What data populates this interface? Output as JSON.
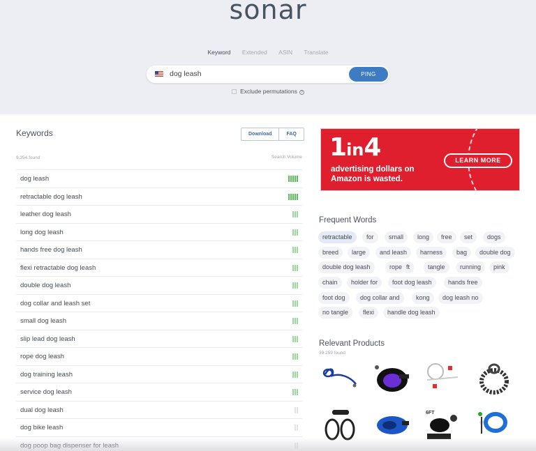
{
  "app": {
    "logo": "sonar"
  },
  "tabs": [
    "Keyword",
    "Extended",
    "ASIN",
    "Translate"
  ],
  "search": {
    "value": "dog leash",
    "button": "PING",
    "flag_icon": "us-flag-icon"
  },
  "exclude_label": "Exclude permutations",
  "keywords": {
    "title": "Keywords",
    "download_label": "Download",
    "faq_label": "FAQ",
    "found": "9.354 found",
    "search_volume_label": "Search Volume",
    "rows": [
      {
        "term": "dog leash",
        "level": 5
      },
      {
        "term": "retractable dog leash",
        "level": 5
      },
      {
        "term": "leather dog leash",
        "level": 3
      },
      {
        "term": "long dog leash",
        "level": 3
      },
      {
        "term": "hands free dog leash",
        "level": 3
      },
      {
        "term": "flexi retractable dog leash",
        "level": 3
      },
      {
        "term": "double dog leash",
        "level": 3
      },
      {
        "term": "dog collar and leash set",
        "level": 3
      },
      {
        "term": "small dog leash",
        "level": 3
      },
      {
        "term": "slip lead dog leash",
        "level": 3
      },
      {
        "term": "rope dog leash",
        "level": 3
      },
      {
        "term": "dog training leash",
        "level": 3
      },
      {
        "term": "service dog leash",
        "level": 3
      },
      {
        "term": "dual dog leash",
        "level": 0
      },
      {
        "term": "dog bike leash",
        "level": 0
      },
      {
        "term": "dog poop bag dispenser for leash",
        "level": 0
      }
    ]
  },
  "ad": {
    "big_1": "1",
    "big_in": "in",
    "big_4": "4",
    "line1": "advertising dollars on",
    "line2": "Amazon is wasted.",
    "cta": "LEARN MORE",
    "bg_color": "#e01f2e"
  },
  "frequent_words": {
    "title": "Frequent Words",
    "words": [
      "retractable",
      "for",
      "small",
      "long",
      "free",
      "set",
      "dogs",
      "breed",
      "large",
      "and leash",
      "harness",
      "bag",
      "double dog",
      "double dog leash",
      "rope",
      "ft",
      "tangle",
      "running",
      "pink",
      "chain",
      "holder for",
      "foot dog leash",
      "hands free",
      "foot dog",
      "dog collar and",
      "kong",
      "dog leash no",
      "no tangle",
      "flexi",
      "handle dog leash"
    ]
  },
  "relevant_products": {
    "title": "Relevant Products",
    "found": "39.259 found",
    "product_label": "6FT"
  },
  "colors": {
    "accent": "#3d7bc3",
    "bar": "#5cc05c"
  }
}
